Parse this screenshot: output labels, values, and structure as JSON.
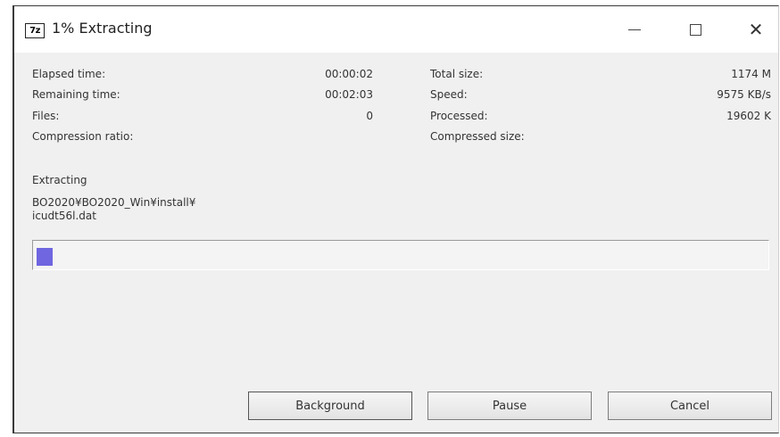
{
  "window": {
    "icon_text": "7z",
    "title": "1% Extracting",
    "controls": {
      "minimize_icon": "minimize-icon",
      "maximize_icon": "maximize-icon",
      "close_icon": "close-icon"
    }
  },
  "stats": {
    "elapsed_label": "Elapsed time:",
    "elapsed_value": "00:00:02",
    "remaining_label": "Remaining time:",
    "remaining_value": "00:02:03",
    "files_label": "Files:",
    "files_value": "0",
    "ratio_label": "Compression ratio:",
    "total_label": "Total size:",
    "total_value": "1174 M",
    "speed_label": "Speed:",
    "speed_value": "9575 KB/s",
    "processed_label": "Processed:",
    "processed_value": "19602 K",
    "compressed_label": "Compressed size:"
  },
  "status": {
    "operation": "Extracting",
    "path_line1": "BO2020¥BO2020_Win¥install¥",
    "path_line2": "icudt56l.dat"
  },
  "progress": {
    "percent": 1,
    "accent": "#6f66e0"
  },
  "buttons": {
    "background": "Background",
    "pause": "Pause",
    "cancel": "Cancel"
  }
}
